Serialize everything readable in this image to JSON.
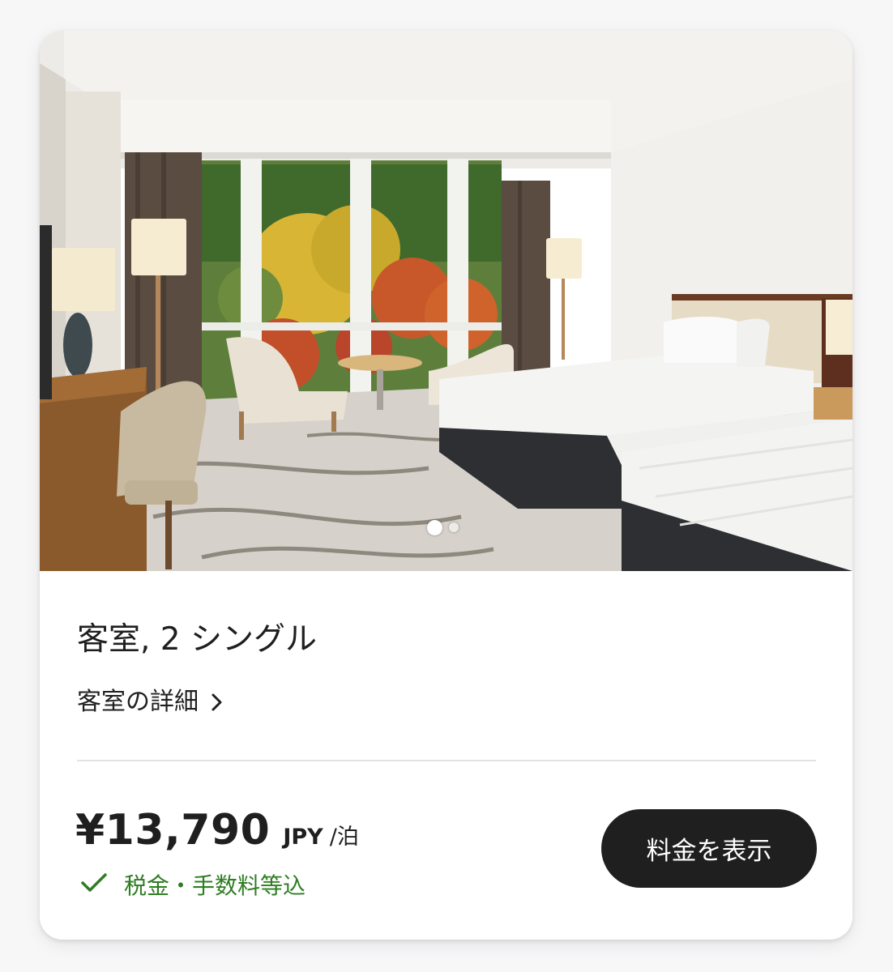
{
  "room": {
    "name": "客室, 2 シングル",
    "details_link": "客室の詳細",
    "photo_alt": "客室写真",
    "carousel": {
      "count": 2,
      "current": 1
    }
  },
  "pricing": {
    "amount": "¥13,790",
    "currency": "JPY",
    "unit": "/泊",
    "tax_note": "税金・手数料等込",
    "cta_label": "料金を表示"
  },
  "icons": {
    "chevron": "chevron-right-icon",
    "check": "checkmark-icon"
  },
  "colors": {
    "accent_green": "#2f7d22",
    "button_bg": "#1f1f1f",
    "text": "#1f1f1f"
  }
}
